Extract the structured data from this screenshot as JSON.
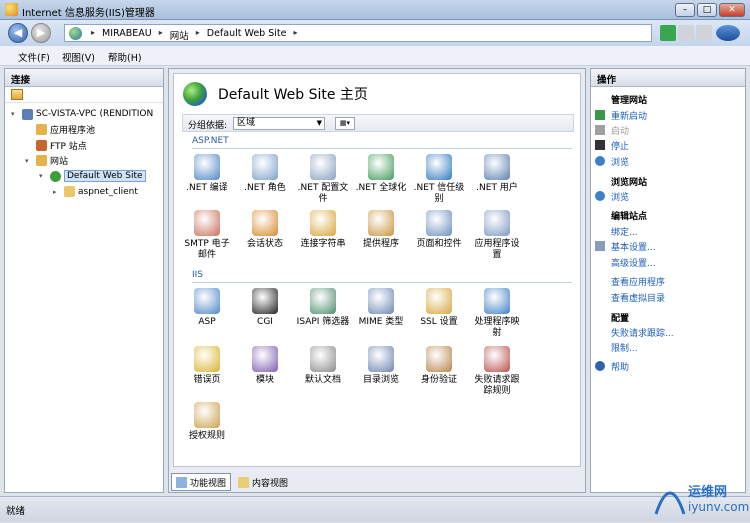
{
  "window": {
    "title": "Internet 信息服务(IIS)管理器"
  },
  "address": {
    "crumbs": [
      "MIRABEAU",
      "网站",
      "Default Web Site"
    ]
  },
  "menu": [
    "文件(F)",
    "视图(V)",
    "帮助(H)"
  ],
  "connections": {
    "header": "连接",
    "tree": [
      {
        "label": "SC-VISTA-VPC (RENDITION",
        "level": 0,
        "expander": "▾"
      },
      {
        "label": "应用程序池",
        "level": 1,
        "expander": ""
      },
      {
        "label": "FTP 站点",
        "level": 1,
        "expander": ""
      },
      {
        "label": "网站",
        "level": 1,
        "expander": "▾"
      },
      {
        "label": "Default Web Site",
        "level": 2,
        "expander": "▾",
        "selected": true
      },
      {
        "label": "aspnet_client",
        "level": 3,
        "expander": "▸"
      }
    ]
  },
  "main": {
    "title": "Default Web Site 主页",
    "group_label": "分组依据:",
    "group_value": "区域",
    "sections": [
      {
        "name": "ASP.NET",
        "features": [
          [
            ".NET 编译"
          ],
          [
            ".NET 角色"
          ],
          [
            ".NET 配置文",
            "件"
          ],
          [
            ".NET 全球化"
          ],
          [
            ".NET 信任级",
            "别"
          ],
          [
            ".NET 用户"
          ],
          [
            "SMTP 电子",
            "邮件"
          ],
          [
            "会话状态"
          ],
          [
            "连接字符串"
          ],
          [
            "提供程序"
          ],
          [
            "页面和控件"
          ],
          [
            "应用程序设",
            "置"
          ]
        ]
      },
      {
        "name": "IIS",
        "features": [
          [
            "ASP"
          ],
          [
            "CGI"
          ],
          [
            "ISAPI 筛选器"
          ],
          [
            "MIME 类型"
          ],
          [
            "SSL 设置"
          ],
          [
            "处理程序映",
            "射"
          ],
          [
            "错误页"
          ],
          [
            "模块"
          ],
          [
            "默认文档"
          ],
          [
            "目录浏览"
          ],
          [
            "身份验证"
          ],
          [
            "失败请求跟",
            "踪规则"
          ],
          [
            "授权规则"
          ]
        ]
      }
    ],
    "tabs": [
      "功能视图",
      "内容视图"
    ]
  },
  "actions": {
    "header": "操作",
    "items": [
      {
        "text": "管理网站",
        "style": "head"
      },
      {
        "text": "重新启动",
        "style": "link",
        "icon": "restart-icon"
      },
      {
        "text": "启动",
        "style": "dim",
        "icon": "start-icon"
      },
      {
        "text": "停止",
        "style": "link",
        "icon": "stop-icon"
      },
      {
        "text": "浏览",
        "style": "link",
        "icon": "browse-icon"
      },
      {
        "text": "浏览网站",
        "style": "head"
      },
      {
        "text": "浏览",
        "style": "link",
        "icon": "browse-icon"
      },
      {
        "text": "编辑站点",
        "style": "head"
      },
      {
        "text": "绑定...",
        "style": "link"
      },
      {
        "text": "基本设置...",
        "style": "link",
        "icon": "settings-icon"
      },
      {
        "text": "高级设置...",
        "style": "link"
      },
      {
        "text": "查看应用程序",
        "style": "link"
      },
      {
        "text": "查看虚拟目录",
        "style": "link"
      },
      {
        "text": "配置",
        "style": "head"
      },
      {
        "text": "失败请求跟踪...",
        "style": "link"
      },
      {
        "text": "限制...",
        "style": "link"
      },
      {
        "text": "帮助",
        "style": "link",
        "icon": "help-icon"
      }
    ]
  },
  "status": "就绪",
  "watermark": {
    "cn": "运维网",
    "en": "iyunv.com"
  }
}
